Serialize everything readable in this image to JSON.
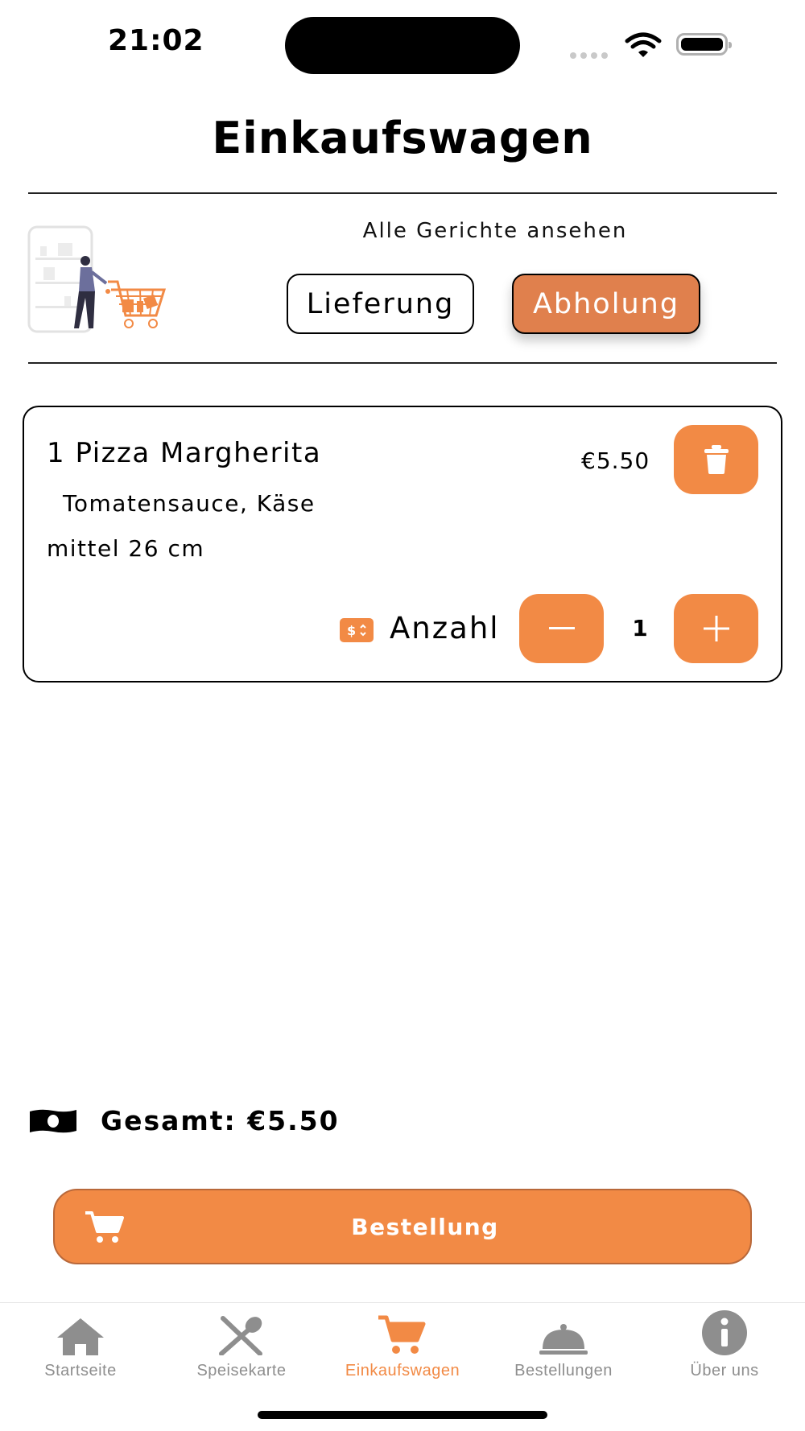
{
  "status_bar": {
    "time": "21:02"
  },
  "header": {
    "title": "Einkaufswagen"
  },
  "delivery": {
    "see_all_label": "Alle Gerichte ansehen",
    "options": [
      "Lieferung",
      "Abholung"
    ],
    "selected": "Abholung"
  },
  "cart": {
    "items": [
      {
        "name": "1 Pizza Margherita",
        "description": "Tomatensauce, Käse",
        "size": "mittel 26 cm",
        "price": "€5.50",
        "quantity_label": "Anzahl",
        "quantity": "1"
      }
    ],
    "total_label": "Gesamt: €5.50",
    "order_button_label": "Bestellung"
  },
  "tabbar": {
    "active": "Einkaufswagen",
    "items": [
      {
        "label": "Startseite",
        "icon": "home-icon"
      },
      {
        "label": "Speisekarte",
        "icon": "fork-spoon-icon"
      },
      {
        "label": "Einkaufswagen",
        "icon": "cart-icon"
      },
      {
        "label": "Bestellungen",
        "icon": "cloche-icon"
      },
      {
        "label": "Über uns",
        "icon": "info-icon"
      }
    ]
  },
  "colors": {
    "accent": "#f28a45",
    "selected_segment": "#e0804d",
    "inactive_tab": "#8e8e8e"
  }
}
